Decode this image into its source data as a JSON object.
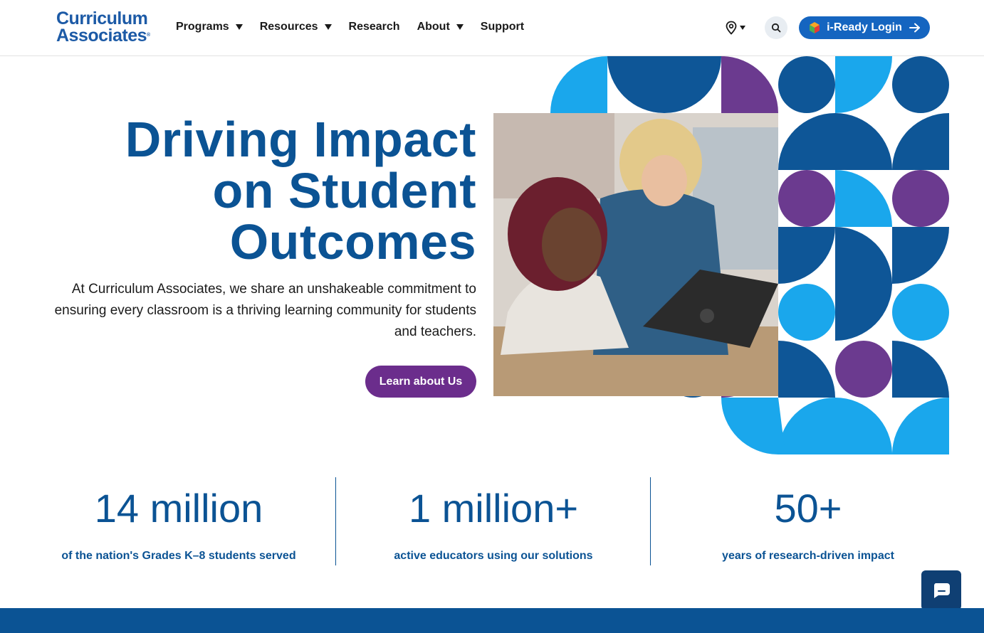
{
  "header": {
    "logo_line1": "Curriculum",
    "logo_line2": "Associates",
    "logo_mark": "®",
    "nav": [
      {
        "label": "Programs",
        "has_dropdown": true
      },
      {
        "label": "Resources",
        "has_dropdown": true
      },
      {
        "label": "Research",
        "has_dropdown": false
      },
      {
        "label": "About",
        "has_dropdown": true
      },
      {
        "label": "Support",
        "has_dropdown": false
      }
    ],
    "location_icon": "map-pin-icon",
    "search_icon": "search-icon",
    "login_label": "i-Ready Login"
  },
  "hero": {
    "title_lines": [
      "Driving Impact",
      "on Student",
      "Outcomes"
    ],
    "text": "At Curriculum Associates, we share an unshakeable commitment to ensuring every classroom is a thriving learning community for students and teachers.",
    "cta_label": "Learn about Us"
  },
  "stats": [
    {
      "value": "14 million",
      "label": "of the nation's Grades K–8 students served"
    },
    {
      "value": "1 million+",
      "label": "active educators using our solutions"
    },
    {
      "value": "50+",
      "label": "years of research-driven impact"
    }
  ],
  "colors": {
    "brand_blue": "#0b5394",
    "button_blue": "#1565c0",
    "purple": "#6b2d8c",
    "light_blue": "#1aa7ec",
    "navy": "#0e5697"
  }
}
